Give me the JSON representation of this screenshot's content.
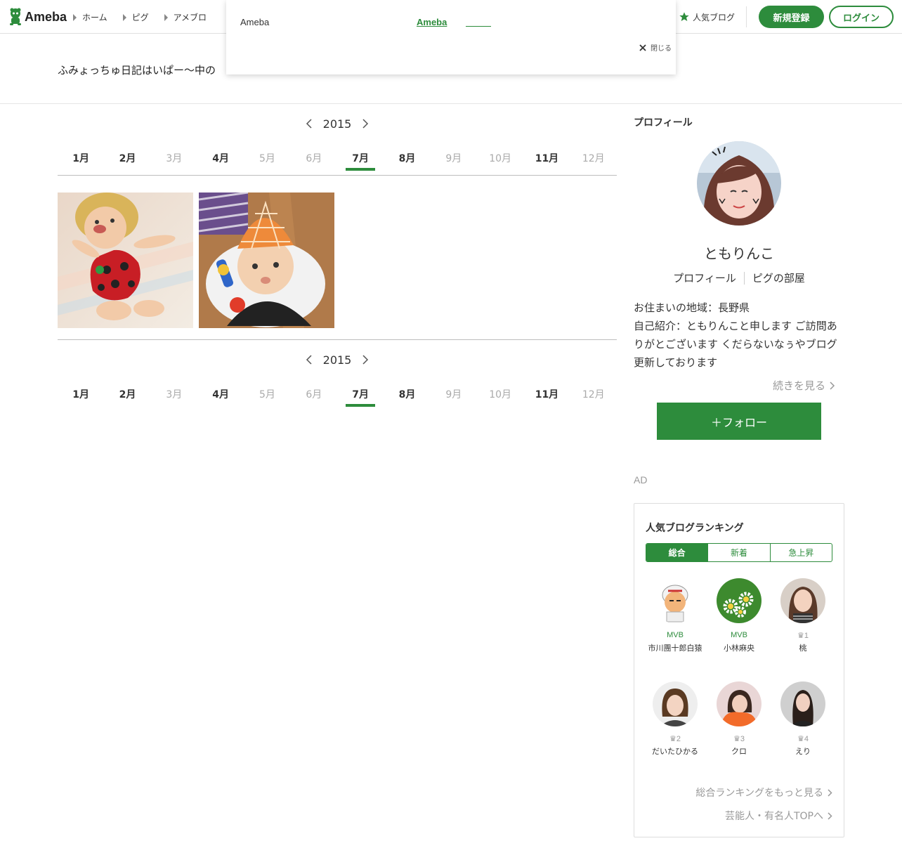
{
  "header": {
    "logo_text": "Ameba",
    "breadcrumbs": [
      "ホーム",
      "ピグ",
      "アメブロ"
    ],
    "popular_label": "人気ブログ",
    "signup_label": "新規登録",
    "login_label": "ログイン"
  },
  "popup": {
    "brand": "Ameba",
    "link": "Ameba",
    "close_label": "閉じる"
  },
  "blog_title": "ふみょっちゅ日記はいぱー〜中の",
  "archive": {
    "year": "2015",
    "months": [
      {
        "label": "1月",
        "active": true
      },
      {
        "label": "2月",
        "active": true
      },
      {
        "label": "3月",
        "active": false
      },
      {
        "label": "4月",
        "active": true
      },
      {
        "label": "5月",
        "active": false
      },
      {
        "label": "6月",
        "active": false
      },
      {
        "label": "7月",
        "active": true,
        "current": true
      },
      {
        "label": "8月",
        "active": true
      },
      {
        "label": "9月",
        "active": false
      },
      {
        "label": "10月",
        "active": false
      },
      {
        "label": "11月",
        "active": true
      },
      {
        "label": "12月",
        "active": false
      }
    ]
  },
  "sidebar": {
    "profile_header": "プロフィール",
    "name": "ともりんこ",
    "links": [
      "プロフィール",
      "ピグの部屋"
    ],
    "info_lines": [
      "お住まいの地域：長野県",
      "自己紹介：ともりんこと申します ご訪問ありがとございます くだらないなぅやブログ更新しております"
    ],
    "more_label": "続きを見る",
    "follow_label": "＋フォロー",
    "ad_label": "AD"
  },
  "ranking": {
    "title": "人気ブログランキング",
    "tabs": [
      "総合",
      "新着",
      "急上昇"
    ],
    "selected_tab": 0,
    "items": [
      {
        "badge": "MVB",
        "name": "市川團十郎白猿"
      },
      {
        "badge": "MVB",
        "name": "小林麻央"
      },
      {
        "badge": "1",
        "name": "桃"
      },
      {
        "badge": "2",
        "name": "だいたひかる"
      },
      {
        "badge": "3",
        "name": "クロ"
      },
      {
        "badge": "4",
        "name": "えり"
      }
    ],
    "more_ranking": "総合ランキングをもっと見る",
    "celebrity_top": "芸能人・有名人TOPへ"
  },
  "colors": {
    "brand_green": "#2d8c3c"
  }
}
